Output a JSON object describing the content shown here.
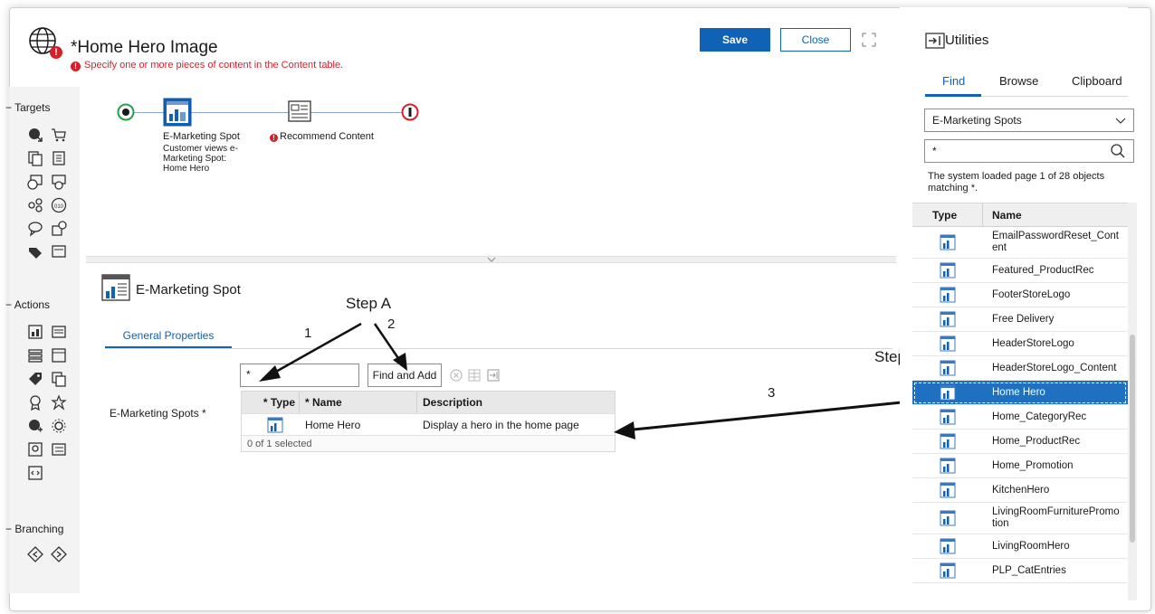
{
  "header": {
    "title": "*Home Hero Image",
    "error_message": "Specify one or more pieces of content in the Content table.",
    "save_label": "Save",
    "close_label": "Close"
  },
  "palette": {
    "targets_label": "Targets",
    "actions_label": "Actions",
    "branching_label": "Branching"
  },
  "flow": {
    "node1_title": "E-Marketing Spot",
    "node1_line1": "Customer views e-",
    "node1_line2": "Marketing Spot:",
    "node1_line3": "Home Hero",
    "node2_title": "Recommend Content"
  },
  "properties": {
    "title": "E-Marketing Spot",
    "tab_general": "General Properties",
    "field_label": "E-Marketing Spots *",
    "search_value": "*",
    "find_add_label": "Find and Add",
    "columns": [
      "* Type",
      "* Name",
      "Description"
    ],
    "rows": [
      {
        "name": "Home Hero",
        "description": "Display a hero in the home page"
      }
    ],
    "footer": "0 of 1 selected"
  },
  "annotations": {
    "step_a": "Step A",
    "step_b": "Step B",
    "num1": "1",
    "num2": "2",
    "num3": "3"
  },
  "utilities": {
    "title": "Utilities",
    "tabs": [
      "Find",
      "Browse",
      "Clipboard"
    ],
    "select_value": "E-Marketing Spots",
    "search_value": "*",
    "status": "The system loaded page 1 of 28 objects matching *.",
    "col_type": "Type",
    "col_name": "Name",
    "items": [
      "EmailPasswordReset_Cont ent",
      "Featured_ProductRec",
      "FooterStoreLogo",
      "Free Delivery",
      "HeaderStoreLogo",
      "HeaderStoreLogo_Content",
      "Home Hero",
      "Home_CategoryRec",
      "Home_ProductRec",
      "Home_Promotion",
      "KitchenHero",
      "LivingRoomFurniturePromo tion",
      "LivingRoomHero",
      "PLP_CatEntries"
    ],
    "selected_item": "Home Hero"
  },
  "colors": {
    "accent": "#0f62b5",
    "error": "#da1e28",
    "selected_row": "#1f70c1"
  }
}
